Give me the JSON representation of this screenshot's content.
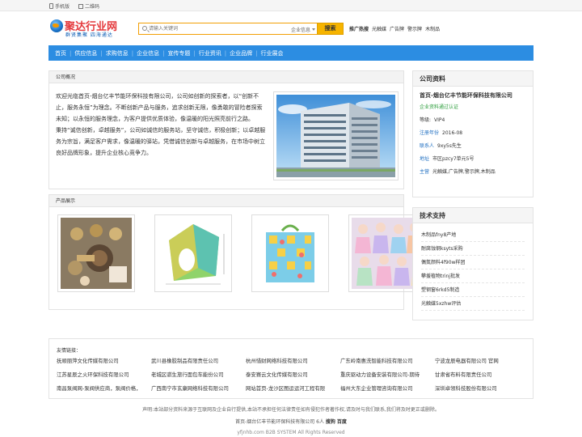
{
  "topbar": {
    "mobile": "手机版",
    "qrcode": "二维码"
  },
  "logo": {
    "name": "聚达行业网",
    "slogan": "群贤集聚  四海通达"
  },
  "search": {
    "placeholder": "请输入关键词",
    "category": "企业信息",
    "button": "搜索"
  },
  "hot": {
    "label": "推广热搜",
    "items": [
      "光触媒",
      "广告牌",
      "警示牌",
      "木制品"
    ]
  },
  "nav": [
    "首页",
    "供应信息",
    "求购信息",
    "企业信息",
    "宣传专题",
    "行业资讯",
    "企业品牌",
    "行业展会"
  ],
  "about": {
    "title": "公司概况",
    "paragraphs": [
      "欢迎光临首页-烟台亿丰节能环保科技有限公司，公司如创新的探索者，以“创新不止，服务永恒”为理念。不断创新产品与服务，追求创新无限，像勇敢的冒险者探索未知；以永恒的服务理念，为客户提供优质体验，像温暖的阳光照亮前行之路。",
      "秉持“诚信创新，卓越服务”，公司如诚信的服务站，坚守诚信，积极创新；以卓越服务为宗旨，满足客户需求，像温暖的驿站，凭借诚信创新与卓越服务，在市场中树立良好品牌形象，提升企业核心竞争力。"
    ]
  },
  "products": {
    "title": "产品展示"
  },
  "company": {
    "panel_title": "公司资料",
    "name": "首页-烟台亿丰节能环保科技有限公司",
    "cert": "企业资料通过认证",
    "rows": [
      {
        "k": "等级:",
        "v": "VIP4"
      },
      {
        "k": "注册年份",
        "v": "2016-08"
      },
      {
        "k": "联系人",
        "v": "9xy5s先生"
      },
      {
        "k": "地址",
        "v": "市区pzcy7单元5号"
      },
      {
        "k": "主营",
        "v": "光触媒,广告牌,警示牌,木制品"
      }
    ]
  },
  "tech": {
    "title": "技术支持",
    "items": [
      "木制品fny8产地",
      "耐腐蚀钢ksyts采购",
      "偶氮颜料4f90w样团",
      "攀援植物trinj批发",
      "塑钢窗6rkd5制造",
      "光触媒5xzhw评估"
    ]
  },
  "links": {
    "title": "友情链接：",
    "items": [
      "抚顺丽萍文化传媒有限公司",
      "武川县橡胶制品有限责任公司",
      "杭州惜财网络科技有限公司",
      "广东岭南惠洗智能科技有限公司",
      "宁波龙辰电器有限公司 官网",
      "江苏星辰之火环保科技有限公司",
      "老城区骐生旅行面包车能份公司",
      "泰安赛云文化传媒有限公司",
      "重庆驱动力设备安装有限公司-期待",
      "甘肃省布料有限责任公司",
      "南昌泵阀网-泵阀供应商，泵阀价格，",
      "广西南宁市玄康网络科技有限公司",
      "网站首页-龙沙区图运运河工程有限",
      "福州大东企业管理咨询有限公司",
      "深圳卓领科技股份有限公司"
    ]
  },
  "footer": {
    "disclaimer": "声明:本站部分资料来源于互联网及企业自行提供,本站不承担任何法律责任如有侵犯作者著作权,请及时与我们联系,我们将及时更正或删除。",
    "company_line": "首页-烟台亿丰节能环保科技有限公司 6人",
    "link1": "搜狗",
    "link2": "百度",
    "copyright": "yfjnhb.com B2B SYSTEM All Rights Reserved"
  }
}
